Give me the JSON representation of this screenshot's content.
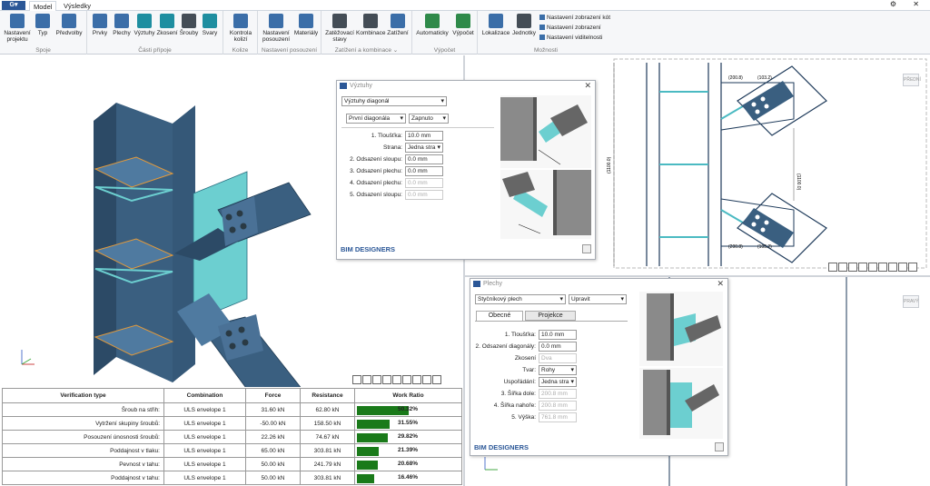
{
  "app": {
    "menu_label": "G▾",
    "tabs": [
      "Model",
      "Výsledky"
    ],
    "window_controls": "⚙ ✕"
  },
  "ribbon": {
    "groups": [
      {
        "label": "Spoje",
        "buttons": [
          "Nastavení projektu",
          "Typ",
          "Předvolby"
        ]
      },
      {
        "label": "Části přípoje",
        "buttons": [
          "Prvky",
          "Plechy",
          "Výztuhy",
          "Zkosení",
          "Šrouby",
          "Svary"
        ]
      },
      {
        "label": "Kolize",
        "buttons": [
          "Kontrola kolizí"
        ]
      },
      {
        "label": "Nastavení posouzení",
        "buttons": [
          "Nastavení posouzení",
          "Materiály"
        ]
      },
      {
        "label": "Zatížení a kombinace ⌄",
        "buttons": [
          "Zatěžovací stavy",
          "Kombinace",
          "Zatížení"
        ]
      },
      {
        "label": "Výpočet",
        "buttons": [
          "Automaticky",
          "Výpočet"
        ]
      },
      {
        "label": "Možnosti",
        "buttons": [
          "Lokalizace",
          "Jednotky"
        ]
      }
    ],
    "small_buttons": [
      "Nastavení zobrazení kót",
      "Nastavení zobrazení",
      "Nastavení viditelnosti"
    ]
  },
  "views": {
    "front_cube": "PŘEDNÍ",
    "right_cube": "PRAVÝ"
  },
  "drawing": {
    "dims": [
      "(200.8)",
      "(103.2)",
      "(1100.0)",
      "(1100.0)",
      "(103.2)",
      "(200.8)"
    ]
  },
  "table": {
    "headers": [
      "Verification type",
      "Combination",
      "Force",
      "Resistance",
      "Work Ratio"
    ],
    "rows": [
      {
        "type": "Šroub na střih:",
        "combination": "ULS envelope 1",
        "force": "31.60 kN",
        "resistance": "62.80 kN",
        "ratio": "50.32%",
        "ratio_value": 50.32
      },
      {
        "type": "Vytržení skupiny šroubů:",
        "combination": "ULS envelope 1",
        "force": "-50.00 kN",
        "resistance": "158.50 kN",
        "ratio": "31.55%",
        "ratio_value": 31.55
      },
      {
        "type": "Posouzení únosnosti šroubů:",
        "combination": "ULS envelope 1",
        "force": "22.26 kN",
        "resistance": "74.67 kN",
        "ratio": "29.82%",
        "ratio_value": 29.82
      },
      {
        "type": "Poddajnost v tlaku:",
        "combination": "ULS envelope 1",
        "force": "65.00 kN",
        "resistance": "303.81 kN",
        "ratio": "21.39%",
        "ratio_value": 21.39
      },
      {
        "type": "Pevnost v tahu:",
        "combination": "ULS envelope 1",
        "force": "50.00 kN",
        "resistance": "241.79 kN",
        "ratio": "20.68%",
        "ratio_value": 20.68
      },
      {
        "type": "Poddajnost v tahu:",
        "combination": "ULS envelope 1",
        "force": "50.00 kN",
        "resistance": "303.81 kN",
        "ratio": "16.46%",
        "ratio_value": 16.46
      }
    ],
    "bar_color": "#1a7a1a"
  },
  "dialog_vyztuhy": {
    "title": "Výztuhy",
    "type_select": "Výztuhy diagonál",
    "which_select": "První diagonála",
    "state_select": "Zapnuto",
    "fields": [
      {
        "label": "1. Tloušťka:",
        "value": "10.0 mm",
        "disabled": false
      },
      {
        "label": "Strana:",
        "value": "Jedna stra",
        "disabled": false
      },
      {
        "label": "2. Odsazení sloupu:",
        "value": "0.0 mm",
        "disabled": false
      },
      {
        "label": "3. Odsazení plechu:",
        "value": "0.0 mm",
        "disabled": false
      },
      {
        "label": "4. Odsazení plechu:",
        "value": "0.0 mm",
        "disabled": true
      },
      {
        "label": "5. Odsazení sloupu:",
        "value": "0.0 mm",
        "disabled": true
      }
    ],
    "logo": "BIM DESIGNERS"
  },
  "dialog_plechy": {
    "title": "Plechy",
    "type_select": "Styčníkový plech",
    "mode_select": "Upravit",
    "tabs": [
      "Obecné",
      "Projekce"
    ],
    "fields": [
      {
        "label": "1. Tloušťka:",
        "value": "10.0 mm",
        "disabled": false
      },
      {
        "label": "2. Odsazení diagonály:",
        "value": "0.0 mm",
        "disabled": false
      },
      {
        "label": "Zkosení",
        "value": "Dva",
        "disabled": true
      },
      {
        "label": "Tvar:",
        "value": "Rohy",
        "disabled": false
      },
      {
        "label": "Uspořádání:",
        "value": "Jedna stra",
        "disabled": false
      },
      {
        "label": "3. Šířka dole:",
        "value": "200.8 mm",
        "disabled": true
      },
      {
        "label": "4. Šířka nahoře:",
        "value": "200.8 mm",
        "disabled": true
      },
      {
        "label": "5. Výška:",
        "value": "761.8 mm",
        "disabled": true
      }
    ],
    "logo": "BIM DESIGNERS"
  },
  "colors": {
    "steel": "#3a5f80",
    "stiffener": "#6ccfd0",
    "accent": "#2b5797"
  }
}
